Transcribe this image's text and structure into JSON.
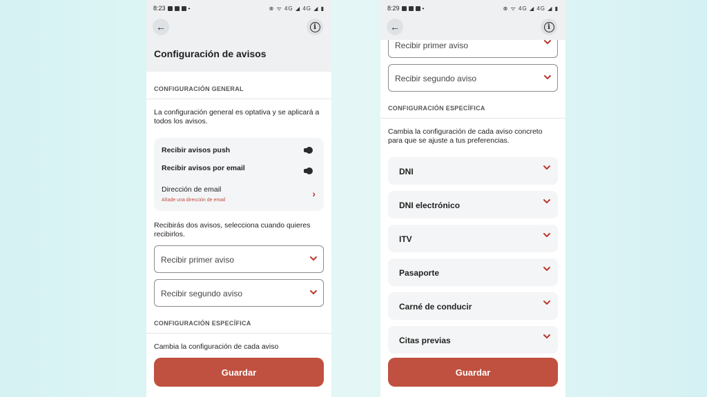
{
  "left": {
    "status_time": "8:23",
    "status_icons": "⊗ ᯤ 4G ◢ 4G ◢ ▮",
    "title": "Configuración de avisos",
    "section_general": "CONFIGURACIÓN GENERAL",
    "general_desc": "La configuración general es optativa y se aplicará a todos los avisos.",
    "push_label": "Recibir avisos push",
    "email_label": "Recibir avisos por email",
    "email_address_label": "Dirección de email",
    "email_address_hint": "Añade una dirección de email",
    "two_notices_desc": "Recibirás dos avisos, selecciona cuando quieres recibirlos.",
    "first_notice": "Recibir primer aviso",
    "second_notice": "Recibir segundo aviso",
    "section_specific": "CONFIGURACIÓN ESPECÍFICA",
    "specific_desc": "Cambia la configuración de cada aviso",
    "save": "Guardar"
  },
  "right": {
    "status_time": "8:29",
    "status_icons": "⊗ ᯤ 4G ◢ 4G ◢ ▮",
    "first_notice": "Recibir primer aviso",
    "second_notice": "Recibir segundo aviso",
    "section_specific": "CONFIGURACIÓN ESPECÍFICA",
    "specific_desc": "Cambia la configuración de cada aviso concreto para que se ajuste a tus preferencias.",
    "items": [
      "DNI",
      "DNI electrónico",
      "ITV",
      "Pasaporte",
      "Carné de conducir",
      "Citas previas"
    ],
    "save": "Guardar"
  },
  "icons": {
    "back": "arrow-left",
    "info": "info-circle",
    "chevron_down": "chevron-down",
    "chevron_right": "chevron-right"
  },
  "colors": {
    "accent": "#c0503f",
    "chevron": "#b8372c",
    "appbar_bg": "#eef0f1",
    "card_bg": "#f4f5f6"
  }
}
